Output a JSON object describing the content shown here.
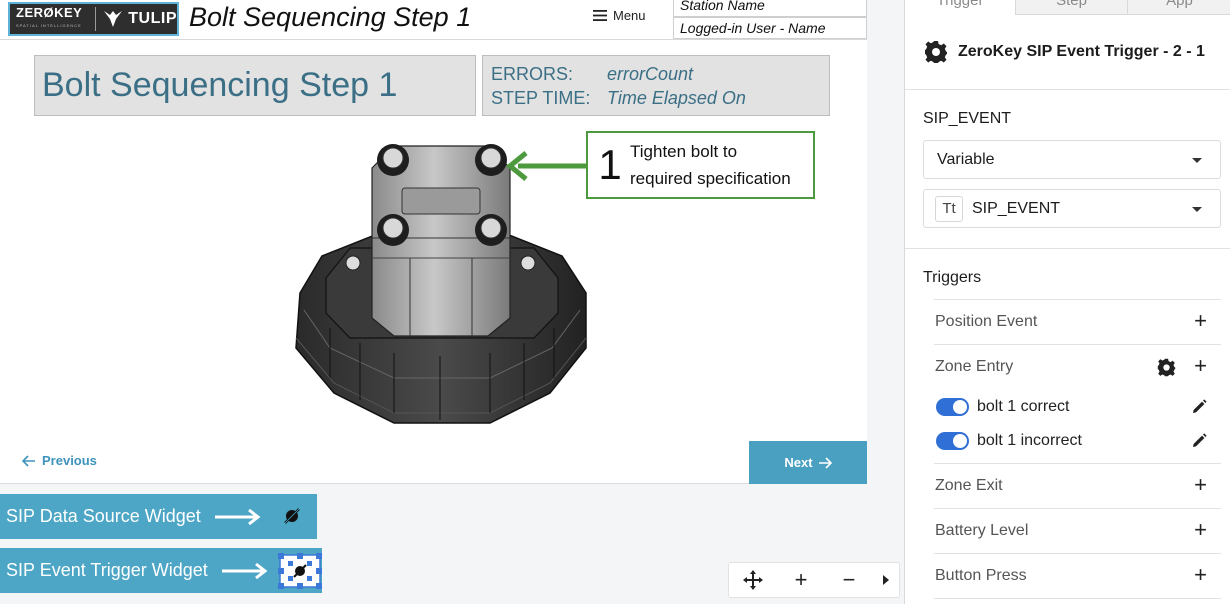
{
  "app_header": {
    "logo_zerokey": "ZERØKEY",
    "logo_tagline": "SPATIAL INTELLIGENCE",
    "logo_tulip": "TULIP",
    "title": "Bolt Sequencing Step 1",
    "menu_label": "Menu",
    "station_name": "Station Name",
    "user_name": "Logged-in User - Name"
  },
  "step": {
    "title": "Bolt Sequencing Step 1",
    "errors_label": "ERRORS:",
    "errors_value": "errorCount",
    "step_time_label": "STEP TIME:",
    "step_time_value": "Time Elapsed On"
  },
  "callout": {
    "number": "1",
    "line1": "Tighten bolt to",
    "line2": "required specification",
    "color": "#4c9a3d"
  },
  "nav": {
    "previous_label": "Previous",
    "next_label": "Next"
  },
  "annotations": {
    "data_source_widget": "SIP Data Source Widget",
    "event_trigger_widget": "SIP Event Trigger Widget"
  },
  "zoom_controls": {
    "move_icon": "move-icon",
    "zoom_in": "+",
    "zoom_out": "−",
    "expand_icon": "caret-right-icon"
  },
  "panel": {
    "tabs": [
      {
        "label": "Trigger"
      },
      {
        "label": "Step"
      },
      {
        "label": "App"
      }
    ],
    "trigger_title": "ZeroKey SIP Event Trigger - 2 - 1",
    "sip_event_label": "SIP_EVENT",
    "source_select": "Variable",
    "variable_select": "SIP_EVENT",
    "variable_type_badge": "Tt",
    "triggers_label": "Triggers",
    "triggers": [
      {
        "label": "Position Event"
      },
      {
        "label": "Zone Entry",
        "children": [
          {
            "label": "bolt 1 correct",
            "enabled": true
          },
          {
            "label": "bolt 1 incorrect",
            "enabled": true
          }
        ]
      },
      {
        "label": "Zone Exit"
      },
      {
        "label": "Battery Level"
      },
      {
        "label": "Button Press"
      }
    ]
  },
  "colors": {
    "accent": "#4aa0c0",
    "title_text": "#3b6f86",
    "toggle_on": "#2f6fd6"
  }
}
